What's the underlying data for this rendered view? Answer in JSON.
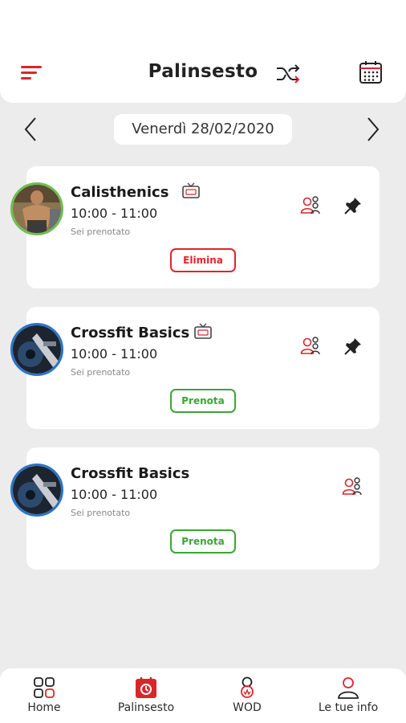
{
  "header": {
    "title": "Palinsesto",
    "icons": {
      "menu": "menu-icon",
      "shuffle": "shuffle-icon",
      "calendar": "calendar-icon"
    }
  },
  "date_nav": {
    "date": "Venerdì 28/02/2020",
    "prev_icon": "chevron-left-icon",
    "next_icon": "chevron-right-icon"
  },
  "classes": [
    {
      "name": "Calisthenics",
      "time": "10:00 - 11:00",
      "status": "Sei prenotato",
      "action": "Elimina",
      "action_color": "#e0242b",
      "has_tv_icon": true,
      "has_pin": true
    },
    {
      "name": "Crossfit Basics",
      "time": "10:00 - 11:00",
      "status": "Sei prenotato",
      "action": "Prenota",
      "action_color": "#3aa635",
      "has_tv_icon": true,
      "has_pin": true
    },
    {
      "name": "Crossfit Basics",
      "time": "10:00 - 11:00",
      "status": "Sei prenotato",
      "action": "Prenota",
      "action_color": "#3aa635",
      "has_tv_icon": false,
      "has_pin": false
    }
  ],
  "bottom_nav": [
    {
      "label": "Home",
      "icon": "home-grid-icon"
    },
    {
      "label": "Palinsesto",
      "icon": "schedule-icon",
      "active": true
    },
    {
      "label": "WOD",
      "icon": "wod-icon"
    },
    {
      "label": "Le tue info",
      "icon": "user-icon"
    }
  ],
  "colors": {
    "accent": "#d8262d",
    "success": "#3aa635",
    "background": "#ececec"
  }
}
